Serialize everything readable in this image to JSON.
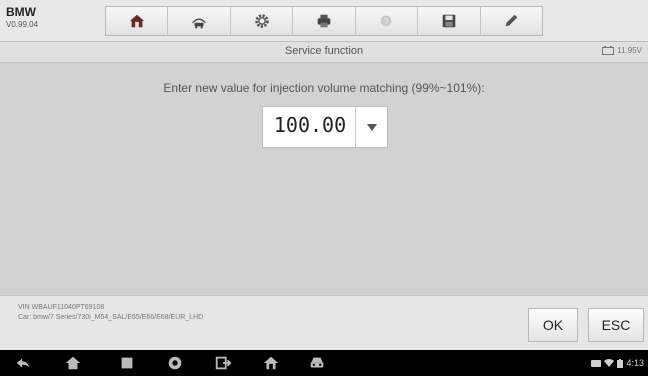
{
  "header": {
    "brand": "BMW",
    "version": "V0.99.04",
    "toolbar": [
      {
        "icon": "home-icon"
      },
      {
        "icon": "vehicle-swap-icon"
      },
      {
        "icon": "settings-gear-icon"
      },
      {
        "icon": "print-icon"
      },
      {
        "icon": "help-icon"
      },
      {
        "icon": "save-icon"
      },
      {
        "icon": "edit-pen-icon"
      }
    ]
  },
  "titlebar": {
    "title": "Service function",
    "battery": "11.95V"
  },
  "main": {
    "prompt": "Enter new value for injection volume matching (99%~101%):",
    "value": "100.00"
  },
  "info": {
    "vin": "VIN WBAUF11040PT69108",
    "car": "Car: bmw/7 Series/730i_M54_SAL/E65/E66/E68/EUR_LHD"
  },
  "buttons": {
    "ok": "OK",
    "esc": "ESC"
  },
  "statusbar": {
    "time": "4:13"
  },
  "colors": {
    "background": "#d2d2d2",
    "navbar": "#000000"
  }
}
